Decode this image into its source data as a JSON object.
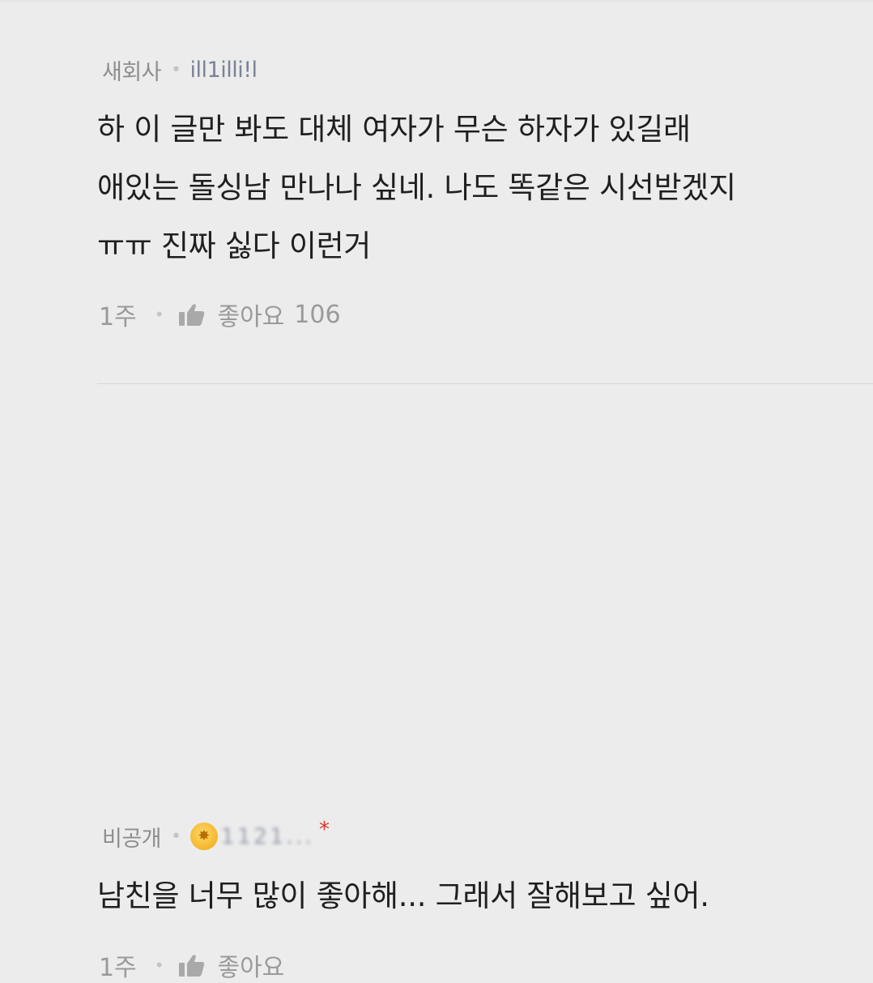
{
  "comments": [
    {
      "author_label": "새회사",
      "nickname": "ill1illi!l",
      "lines": [
        "하 이 글만 봐도 대체 여자가 무슨 하자가 있길래",
        "애있는 돌싱남 만나나 싶네. 나도 똑같은 시선받겠지",
        "ㅠㅠ 진짜 싫다 이런거"
      ],
      "time": "1주",
      "like_label": "좋아요",
      "like_count": "106"
    },
    {
      "author_label": "비공개",
      "nickname": "1121...",
      "author_marker": "*",
      "lines": [
        "남친을 너무 많이 좋아해... 그래서 잘해보고 싶어."
      ],
      "time": "1주",
      "like_label": "좋아요"
    }
  ],
  "colors": {
    "background": "#ececec",
    "meta_text": "#8e8e8e",
    "nickname": "#7a8296",
    "badge": "#f3b52b",
    "marker": "#d73a2e"
  },
  "icons": [
    "thumbs-up-icon",
    "medal-badge-icon"
  ]
}
